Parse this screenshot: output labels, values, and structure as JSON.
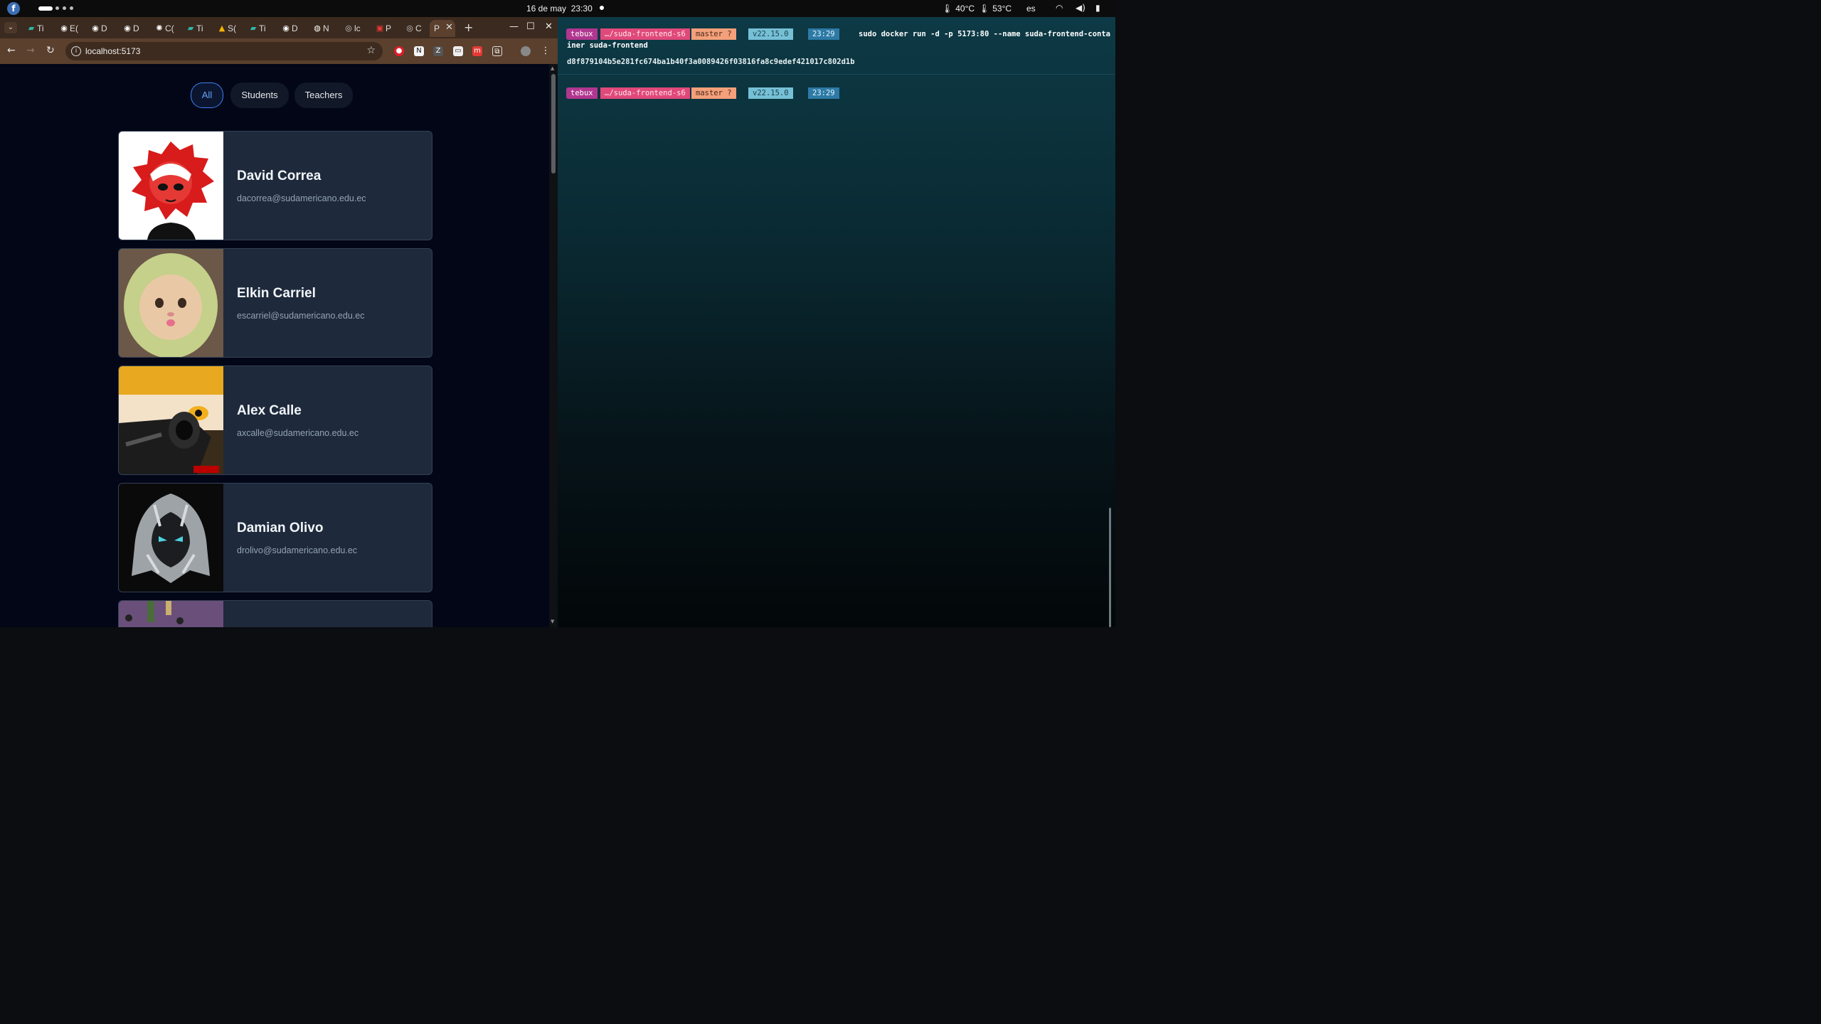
{
  "topbar": {
    "date": "16 de may",
    "time": "23:30",
    "temp_cpu": "40°C",
    "temp_gpu": "53°C",
    "language": "es"
  },
  "browser": {
    "tabs": [
      {
        "label": "Ti",
        "icon": "terminal-app-icon",
        "color": "#2fb6a8"
      },
      {
        "label": "E(",
        "icon": "github-icon",
        "color": "#ffffff"
      },
      {
        "label": "D",
        "icon": "github-icon",
        "color": "#ffffff"
      },
      {
        "label": "D",
        "icon": "github-icon",
        "color": "#ffffff"
      },
      {
        "label": "C(",
        "icon": "openai-icon",
        "color": "#ffffff"
      },
      {
        "label": "Ti",
        "icon": "terminal-app-icon",
        "color": "#2fb6a8"
      },
      {
        "label": "S(",
        "icon": "google-drive-icon",
        "color": "#f4b400"
      },
      {
        "label": "Ti",
        "icon": "terminal-app-icon",
        "color": "#2fb6a8"
      },
      {
        "label": "D",
        "icon": "github-icon",
        "color": "#ffffff"
      },
      {
        "label": "N",
        "icon": "chrome-icon",
        "color": "#ffffff"
      },
      {
        "label": "lc",
        "icon": "globe-icon",
        "color": "#cccccc"
      },
      {
        "label": "P",
        "icon": "pdf-icon",
        "color": "#e53935"
      },
      {
        "label": "C",
        "icon": "globe-icon",
        "color": "#cccccc"
      },
      {
        "label": "P",
        "icon": "globe-icon",
        "color": "#cccccc",
        "active": true
      }
    ],
    "url": "localhost:5173"
  },
  "page": {
    "filters": [
      "All",
      "Students",
      "Teachers"
    ],
    "active_filter": "All",
    "people": [
      {
        "name": "David Correa",
        "email": "dacorrea@sudamericano.edu.ec",
        "avatar": "red-anime-avatar"
      },
      {
        "name": "Elkin Carriel",
        "email": "escarriel@sudamericano.edu.ec",
        "avatar": "cat-avocado-avatar"
      },
      {
        "name": "Alex Calle",
        "email": "axcalle@sudamericano.edu.ec",
        "avatar": "anime-armor-avatar"
      },
      {
        "name": "Damian Olivo",
        "email": "drolivo@sudamericano.edu.ec",
        "avatar": "moon-knight-avatar"
      },
      {
        "name": "",
        "email": "",
        "avatar": "purple-partial-avatar"
      }
    ]
  },
  "terminal": {
    "prompt": {
      "user": "tebux",
      "path": "…/suda-frontend-s6",
      "branch": "master ?",
      "node": "v22.15.0",
      "time": "23:29"
    },
    "command_line1": "sudo docker run -d -p 5173:80 --name suda-frontend-conta",
    "command_line2": "iner suda-frontend",
    "output": "d8f879104b5e281fc674ba1b40f3a0089426f03816fa8c9edef421017c802d1b",
    "prompt2": {
      "user": "tebux",
      "path": "…/suda-frontend-s6",
      "branch": "master ?",
      "node": "v22.15.0",
      "time": "23:29"
    }
  }
}
